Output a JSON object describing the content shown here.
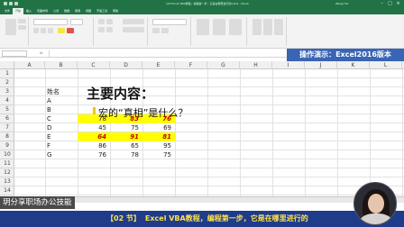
{
  "window": {
    "title": "[02 Excel VBA教程，编程第一步，它是在哪里进行的].xlsx - Excel",
    "user": "Wang Hui"
  },
  "ribbon_tabs": [
    "文件",
    "开始",
    "插入",
    "页面布局",
    "公式",
    "数据",
    "审阅",
    "视图",
    "开发工具",
    "帮助"
  ],
  "formula_bar": {
    "name_box": "",
    "fx": "fx",
    "content": ""
  },
  "banner": "操作演示：Excel2016版本",
  "column_headers": [
    "A",
    "B",
    "C",
    "D",
    "E",
    "F",
    "G",
    "H",
    "I",
    "J",
    "K",
    "L"
  ],
  "row_headers": [
    "1",
    "2",
    "3",
    "4",
    "5",
    "6",
    "7",
    "8",
    "9",
    "10",
    "11",
    "12",
    "13",
    "14"
  ],
  "sheet": {
    "heading": "主要内容：",
    "question": "宏的“真相”是什么？",
    "name_header": "姓名",
    "names": [
      "A",
      "B",
      "C",
      "D",
      "E",
      "F",
      "G"
    ],
    "rows": [
      {
        "c": "",
        "d": "",
        "e": ""
      },
      {
        "c": "",
        "d": "",
        "e": ""
      },
      {
        "c": "78",
        "d": "83",
        "e": "76"
      },
      {
        "c": "45",
        "d": "75",
        "e": "69"
      },
      {
        "c": "64",
        "d": "91",
        "e": "81"
      },
      {
        "c": "86",
        "d": "65",
        "e": "95"
      },
      {
        "c": "76",
        "d": "78",
        "e": "75"
      }
    ],
    "highlight_color": "#ffff00",
    "highlight_text_color": "#c00000"
  },
  "watermark": "玥分享职场办公技能",
  "subtitle": {
    "lesson": "【02 节】",
    "text": "Excel VBA教程，编程第一步，它是在哪里进行的"
  },
  "colors": {
    "excel_green": "#217346",
    "banner_blue": "#3a64b4",
    "subtitle_bg": "#1e3c8a",
    "subtitle_text": "#ffe04a"
  }
}
